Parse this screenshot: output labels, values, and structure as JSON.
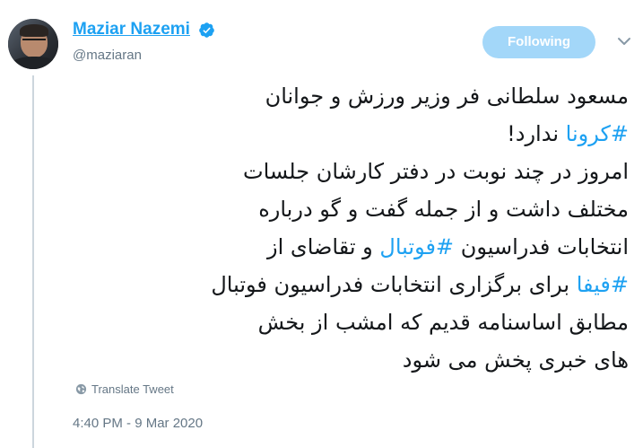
{
  "author": {
    "display_name": "Maziar Nazemi",
    "handle": "@maziaran",
    "verified": true
  },
  "follow_button": {
    "label": "Following"
  },
  "icons": {
    "verified": "verified-badge-icon",
    "caret": "chevron-down-icon",
    "translate": "globe-icon"
  },
  "colors": {
    "accent": "#1da1f2",
    "button_bg": "#a3d7f9",
    "secondary_text": "#657786",
    "body_text": "#14171a",
    "thread_line": "#ccd6dd"
  },
  "tweet": {
    "lines": {
      "l1": "مسعود سلطانی فر وزیر ورزش و جوانان",
      "l2_tag": "#کرونا",
      "l2_rest": "ندارد!",
      "l3": "امروز در چند نوبت در دفتر کارشان جلسات",
      "l4": "مختلف داشت و از جمله گفت و گو درباره",
      "l5_pre": "انتخابات فدراسیون",
      "l5_tag": "#فوتبال",
      "l5_post": "و تقاضای از",
      "l6_tag": "#فیفا",
      "l6_rest": "برای برگزاری انتخابات فدراسیون فوتبال",
      "l7": "مطابق اساسنامه قدیم که امشب از بخش",
      "l8": "های خبری پخش می شود"
    },
    "translate_label": "Translate Tweet",
    "timestamp": "4:40 PM - 9 Mar 2020"
  }
}
